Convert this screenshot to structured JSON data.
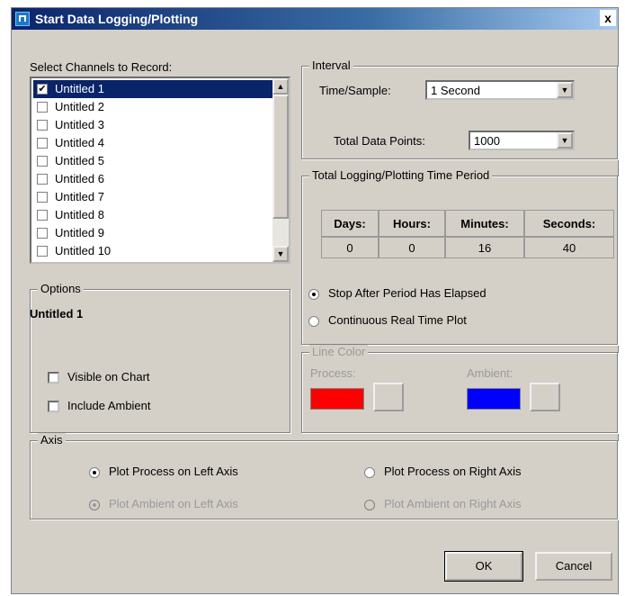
{
  "window": {
    "title": "Start Data Logging/Plotting",
    "close": "x"
  },
  "channels": {
    "label": "Select Channels to Record:",
    "items": [
      {
        "label": "Untitled 1",
        "checked": true
      },
      {
        "label": "Untitled 2",
        "checked": false
      },
      {
        "label": "Untitled 3",
        "checked": false
      },
      {
        "label": "Untitled 4",
        "checked": false
      },
      {
        "label": "Untitled 5",
        "checked": false
      },
      {
        "label": "Untitled 6",
        "checked": false
      },
      {
        "label": "Untitled 7",
        "checked": false
      },
      {
        "label": "Untitled 8",
        "checked": false
      },
      {
        "label": "Untitled 9",
        "checked": false
      },
      {
        "label": "Untitled 10",
        "checked": false
      }
    ],
    "check_mark": "✔"
  },
  "interval": {
    "title": "Interval",
    "time_label": "Time/Sample:",
    "time_value": "1 Second",
    "points_label": "Total Data Points:",
    "points_value": "1000"
  },
  "period": {
    "title": "Total Logging/Plotting Time Period",
    "headers": [
      "Days:",
      "Hours:",
      "Minutes:",
      "Seconds:"
    ],
    "values": [
      "0",
      "0",
      "16",
      "40"
    ],
    "stop_label": "Stop After Period Has Elapsed",
    "continuous_label": "Continuous Real Time Plot"
  },
  "options": {
    "title": "Options",
    "channel_name": "Untitled 1",
    "visible_label": "Visible on Chart",
    "ambient_label": "Include Ambient"
  },
  "line_color": {
    "title": "Line Color",
    "process_label": "Process:",
    "ambient_label": "Ambient:",
    "process_color": "#ff0000",
    "ambient_color": "#0000ff"
  },
  "axis": {
    "title": "Axis",
    "process_left": "Plot Process on Left Axis",
    "process_right": "Plot Process on Right Axis",
    "ambient_left": "Plot Ambient on Left Axis",
    "ambient_right": "Plot Ambient on Right Axis"
  },
  "buttons": {
    "ok": "OK",
    "cancel": "Cancel"
  }
}
